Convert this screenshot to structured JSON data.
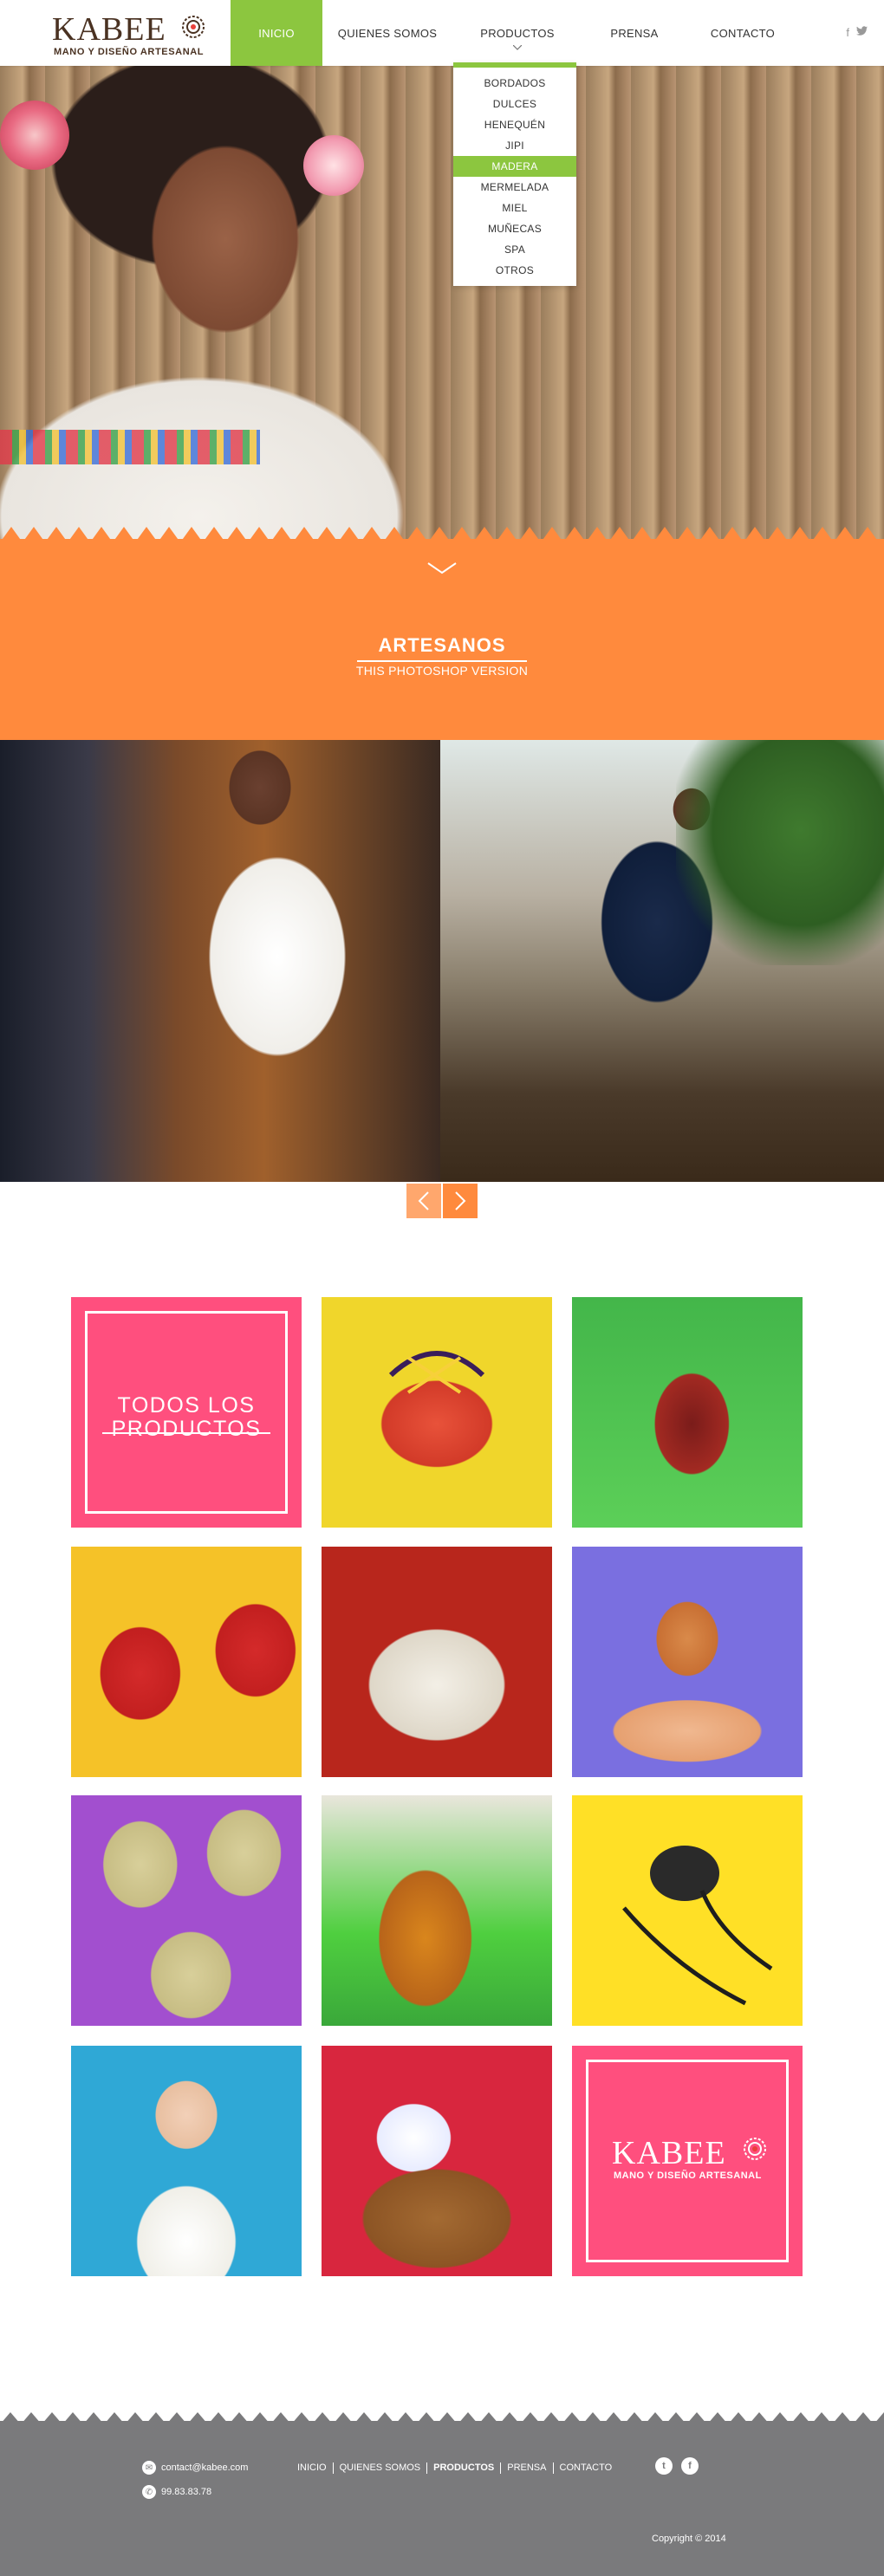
{
  "brand": {
    "name": "KABEE",
    "tagline": "MANO Y DISEÑO ARTESANAL"
  },
  "nav": {
    "items": [
      {
        "label": "INICIO",
        "active": true
      },
      {
        "label": "QUIENES SOMOS",
        "active": false
      },
      {
        "label": "PRODUCTOS",
        "active": false
      },
      {
        "label": "PRENSA",
        "active": false
      },
      {
        "label": "CONTACTO",
        "active": false
      }
    ],
    "social": [
      "f",
      "t"
    ]
  },
  "dropdown": {
    "items": [
      {
        "label": "BORDADOS"
      },
      {
        "label": "DULCES"
      },
      {
        "label": "HENEQUÉN"
      },
      {
        "label": "JIPI"
      },
      {
        "label": "MADERA",
        "active": true
      },
      {
        "label": "MERMELADA"
      },
      {
        "label": "MIEL"
      },
      {
        "label": "MUÑECAS"
      },
      {
        "label": "SPA"
      },
      {
        "label": "OTROS"
      }
    ]
  },
  "band": {
    "title": "ARTESANOS",
    "subtitle": "THIS PHOTOSHOP VERSION"
  },
  "products": {
    "all_label": "TODOS LOS PRODUCTOS",
    "tiles": [
      {
        "name": "todos-tile",
        "color": "#ff4f7e"
      },
      {
        "name": "woven-basket-tile",
        "color": "#f0d62b"
      },
      {
        "name": "jam-jar-tile",
        "color": "#3fb24a"
      },
      {
        "name": "red-birds-tile",
        "color": "#f5c228"
      },
      {
        "name": "spa-bowl-tile",
        "color": "#b8261c"
      },
      {
        "name": "candy-jars-tile",
        "color": "#7a6fe0"
      },
      {
        "name": "straw-hearts-tile",
        "color": "#a24fcf"
      },
      {
        "name": "honey-jar-tile",
        "color": "#4fcf3f"
      },
      {
        "name": "turtle-necklace-tile",
        "color": "#ffe026"
      },
      {
        "name": "doll-tile",
        "color": "#2fa8d6"
      },
      {
        "name": "gift-basket-tile",
        "color": "#d8263e"
      },
      {
        "name": "kabee-logo-tile",
        "color": "#ff4f7e"
      }
    ]
  },
  "footer": {
    "email": "contact@kabee.com",
    "phone": "99.83.83.78",
    "nav": [
      {
        "label": "INICIO"
      },
      {
        "label": "QUIENES SOMOS"
      },
      {
        "label": "PRODUCTOS",
        "active": true
      },
      {
        "label": "PRENSA"
      },
      {
        "label": "CONTACTO"
      }
    ],
    "social": [
      "t",
      "f"
    ],
    "copyright": "Copyright © 2014"
  }
}
